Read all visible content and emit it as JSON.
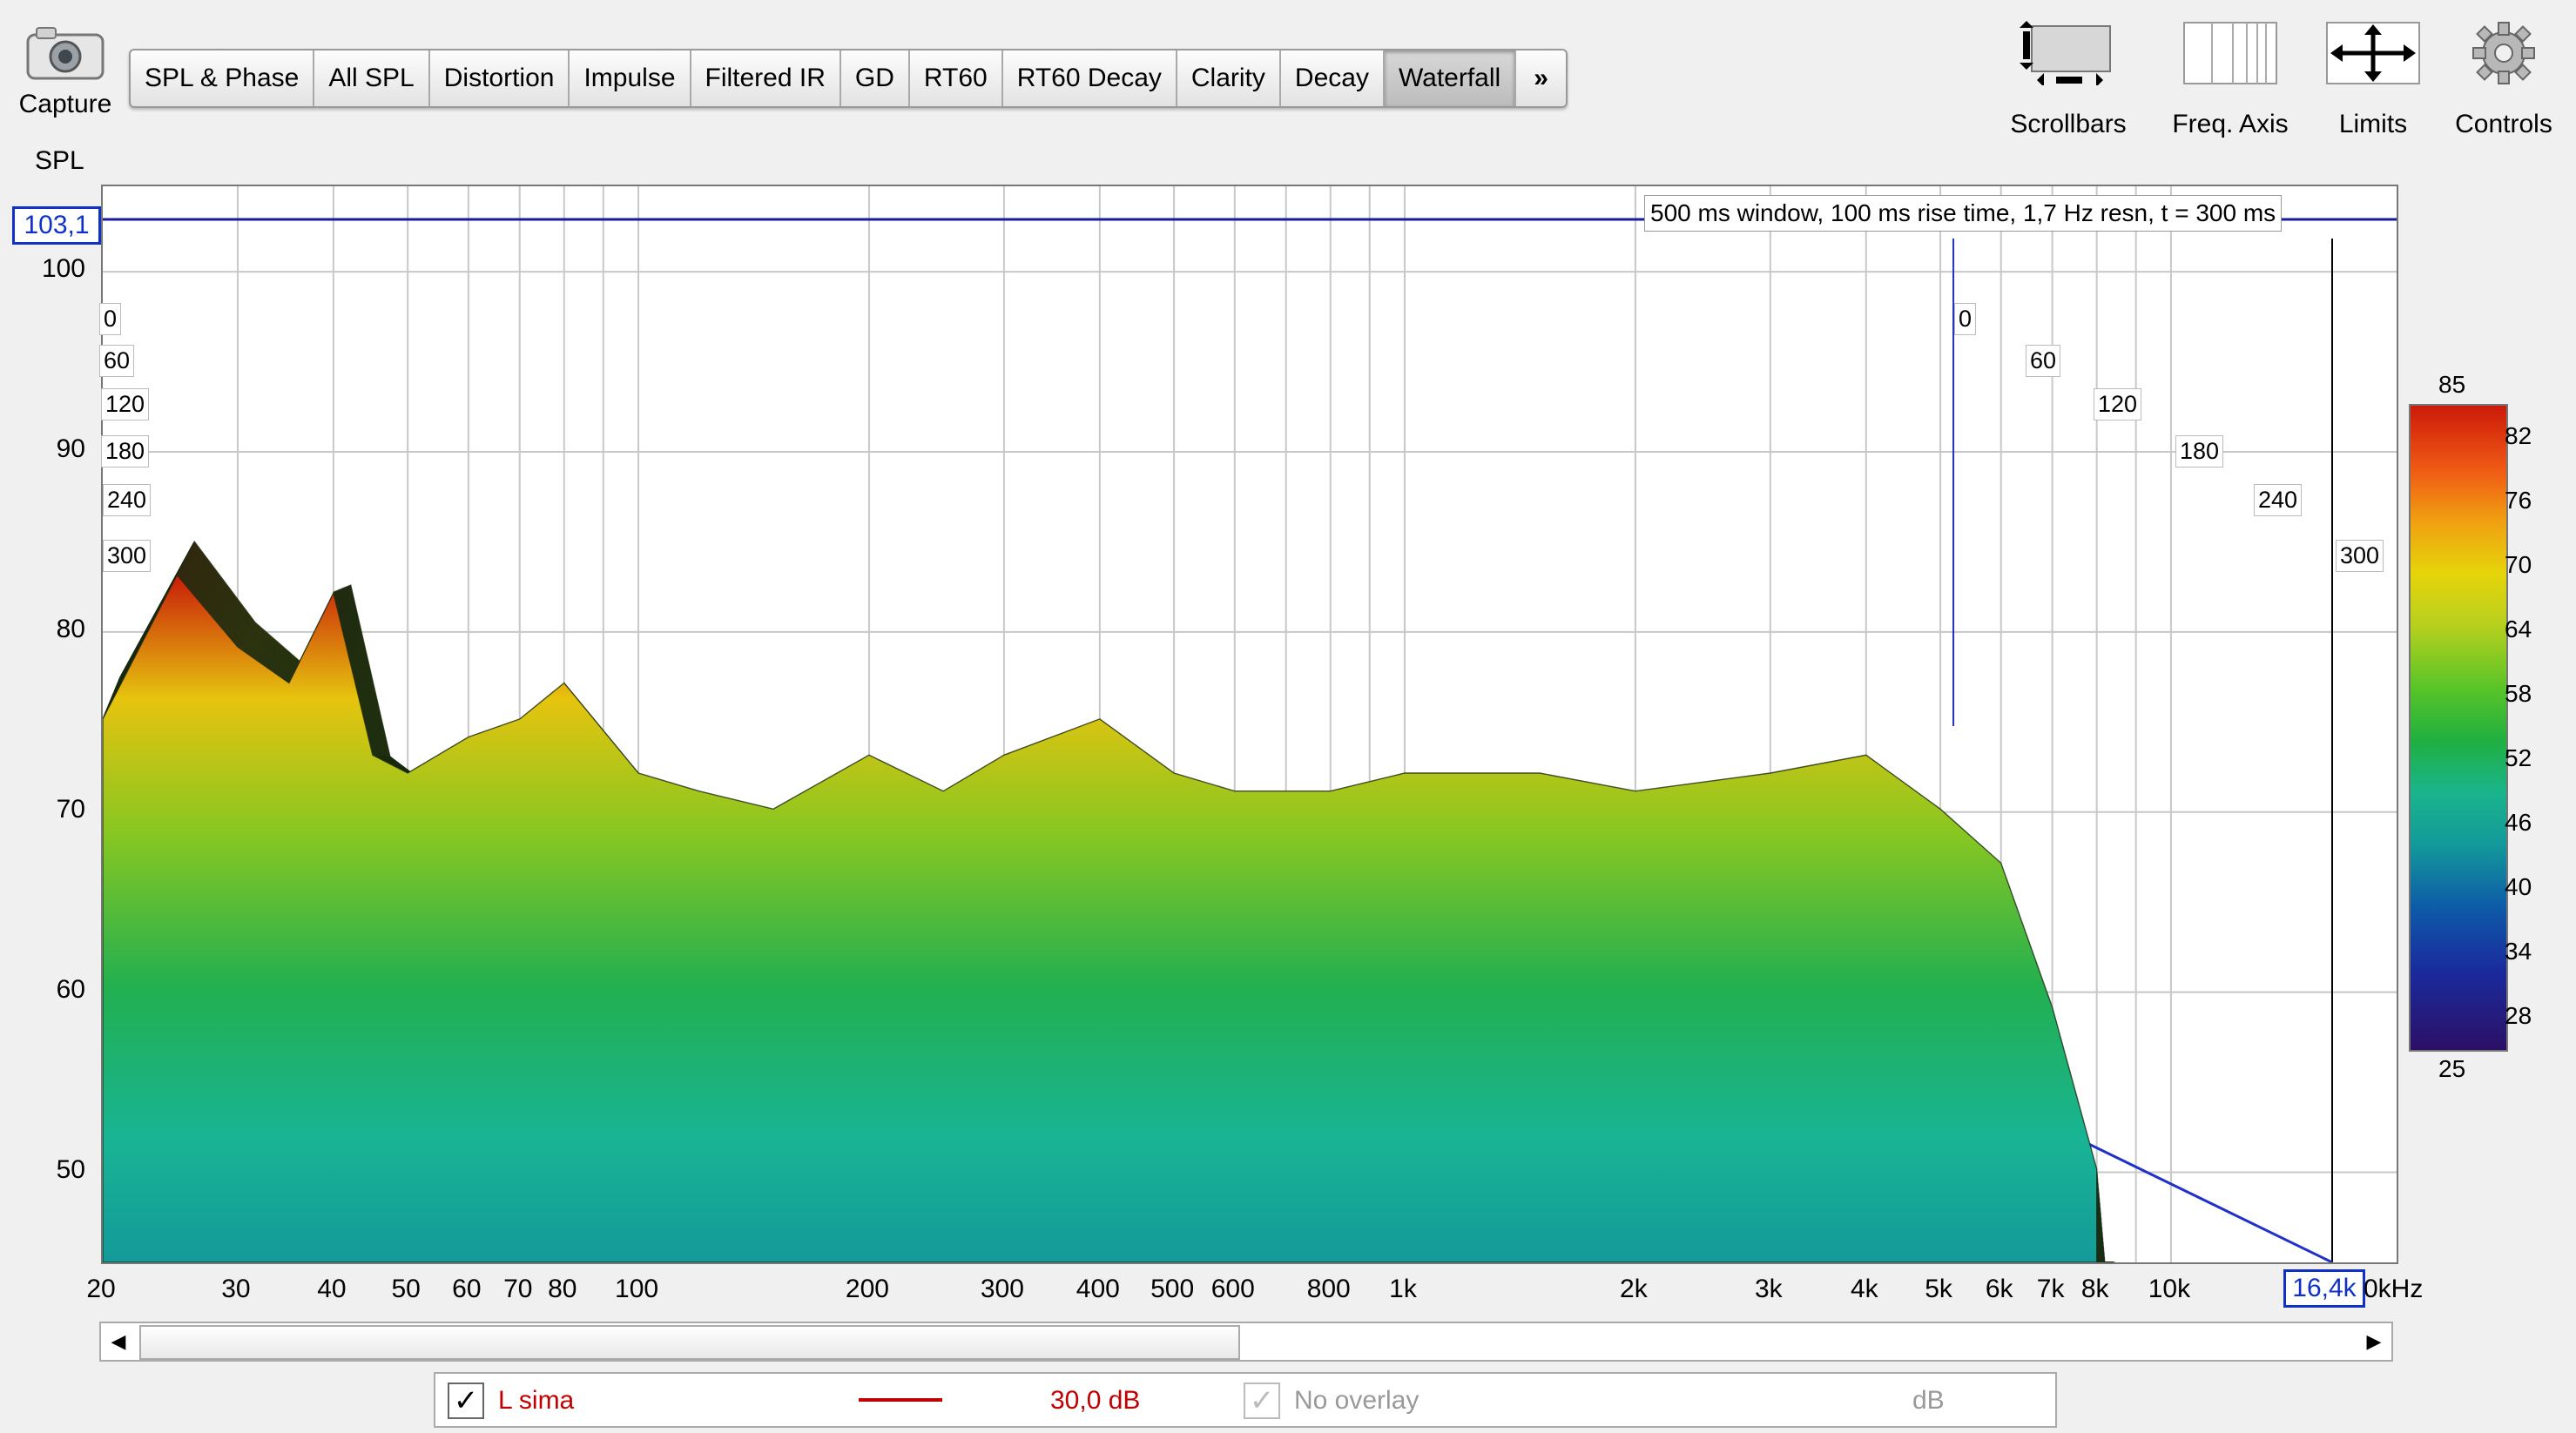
{
  "toolbar": {
    "capture_label": "Capture",
    "tabs": [
      "SPL & Phase",
      "All SPL",
      "Distortion",
      "Impulse",
      "Filtered IR",
      "GD",
      "RT60",
      "RT60 Decay",
      "Clarity",
      "Decay",
      "Waterfall"
    ],
    "active_tab": "Waterfall",
    "more_label": "»",
    "tools": [
      "Scrollbars",
      "Freq. Axis",
      "Limits",
      "Controls"
    ]
  },
  "plot": {
    "y_title": "SPL",
    "y_top_value": "103,1",
    "y_ticks": [
      "100",
      "90",
      "80",
      "70",
      "60",
      "50"
    ],
    "x_ticks": [
      "20",
      "30",
      "40",
      "50",
      "60",
      "70",
      "80",
      "100",
      "200",
      "300",
      "400",
      "500",
      "600",
      "800",
      "1k",
      "2k",
      "3k",
      "4k",
      "5k",
      "6k",
      "7k",
      "8k",
      "10k"
    ],
    "x_end_value": "16,4k",
    "x_unit": "0kHz",
    "info_banner": "500 ms window, 100 ms rise time, 1,7 Hz resn, t = 300 ms",
    "time_labels_left": [
      "0",
      "60",
      "120",
      "180",
      "240",
      "300"
    ],
    "time_labels_right": [
      "0",
      "60",
      "120",
      "180",
      "240",
      "300"
    ]
  },
  "colorbar": {
    "max": "85",
    "min": "25",
    "ticks": [
      "82",
      "76",
      "70",
      "64",
      "58",
      "52",
      "46",
      "40",
      "34",
      "28"
    ]
  },
  "legend": {
    "series_name": "L sima",
    "series_color": "#c00000",
    "series_offset": "30,0 dB",
    "overlay_label": "No overlay",
    "overlay_unit": "dB"
  },
  "chart_data": {
    "type": "area",
    "view": "waterfall (3D spectral decay)",
    "x_scale": "log",
    "xlim": [
      20,
      16400
    ],
    "ylim": [
      45,
      103.1
    ],
    "z_label_values": [
      0,
      60,
      120,
      180,
      240,
      300
    ],
    "color_range": [
      25,
      85
    ],
    "x": [
      20,
      25,
      30,
      35,
      40,
      45,
      50,
      60,
      70,
      80,
      100,
      120,
      150,
      200,
      250,
      300,
      400,
      500,
      600,
      800,
      1000,
      1500,
      2000,
      3000,
      4000,
      5000,
      6000,
      7000,
      8000
    ],
    "front_slice_spl": [
      80,
      88,
      84,
      82,
      87,
      78,
      77,
      79,
      80,
      82,
      77,
      76,
      75,
      78,
      76,
      78,
      80,
      77,
      76,
      76,
      77,
      77,
      76,
      77,
      78,
      75,
      72,
      64,
      55
    ]
  }
}
